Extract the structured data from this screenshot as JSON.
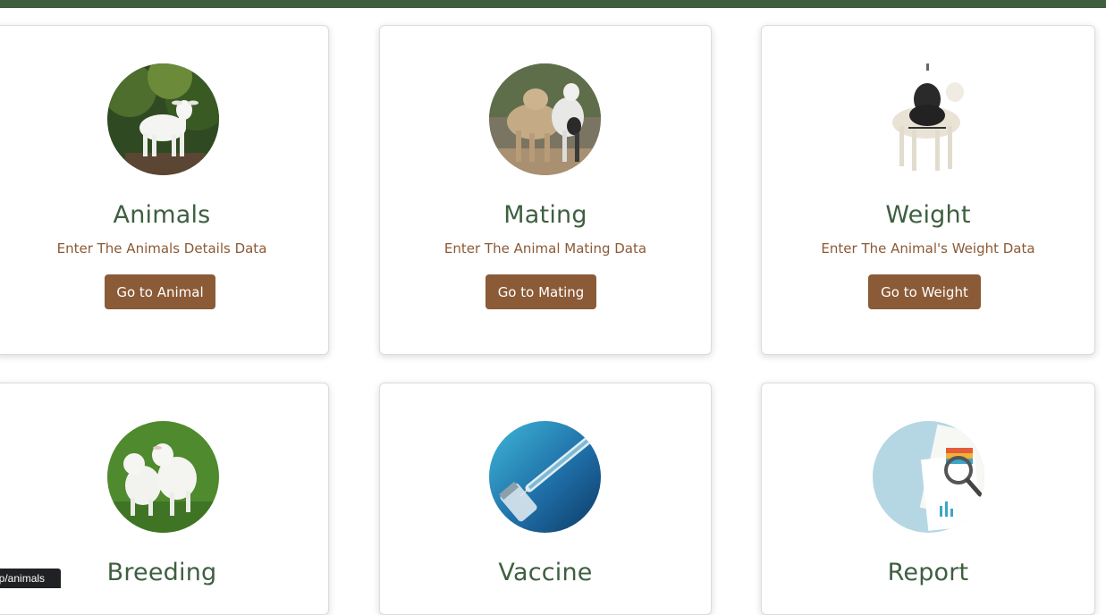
{
  "cards": [
    {
      "title": "Animals",
      "description": "Enter The Animals Details Data",
      "button": "Go to Animal",
      "image_icon": "white-goat-kid-photo"
    },
    {
      "title": "Mating",
      "description": "Enter The Animal Mating Data",
      "button": "Go to Mating",
      "image_icon": "two-goats-photo"
    },
    {
      "title": "Weight",
      "description": "Enter The Animal's Weight Data",
      "button": "Go to Weight",
      "image_icon": "lamb-in-weighing-sling-photo"
    },
    {
      "title": "Breeding",
      "image_icon": "two-goat-kids-on-grass-photo"
    },
    {
      "title": "Vaccine",
      "image_icon": "syringe-and-vial-photo"
    },
    {
      "title": "Report",
      "image_icon": "report-magnifier-photo"
    }
  ],
  "status_bar": {
    "url_text": "pp/animals"
  },
  "colors": {
    "top_bar": "#3f5f3f",
    "title": "#3e5f40",
    "accent_brown": "#8b5a36"
  }
}
